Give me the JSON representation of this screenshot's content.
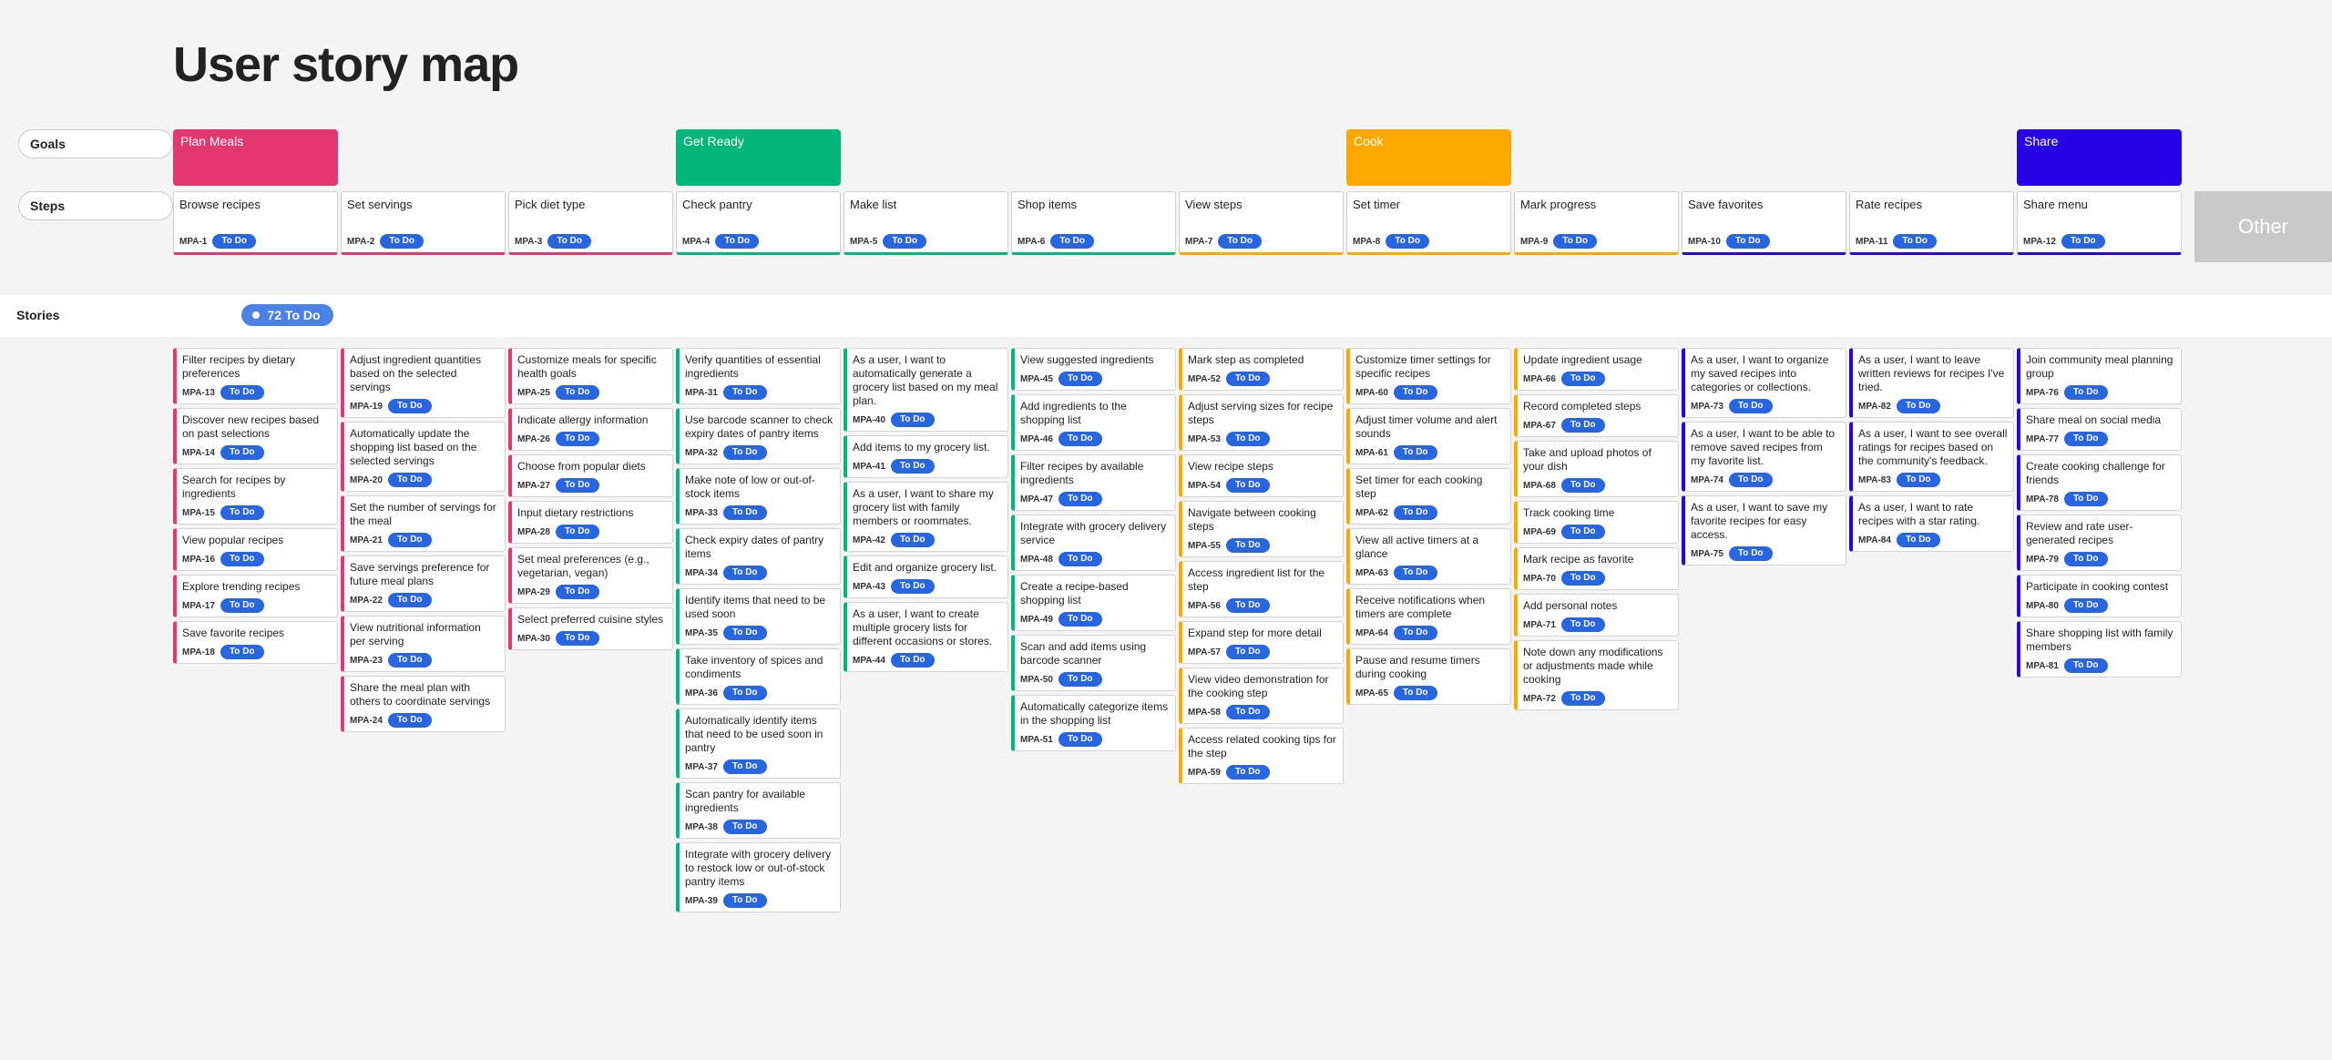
{
  "title": "User story map",
  "labels": {
    "goals": "Goals",
    "steps": "Steps",
    "stories": "Stories",
    "other": "Other"
  },
  "status_label": "To Do",
  "todo_chip": "72 To Do",
  "goals": [
    {
      "title": "Plan Meals",
      "color": "pink",
      "span": 3
    },
    {
      "title": "Get Ready",
      "color": "green",
      "span": 4
    },
    {
      "title": "Cook",
      "color": "orange",
      "span": 4
    },
    {
      "title": "Share",
      "color": "blue",
      "span": 3
    }
  ],
  "steps": [
    {
      "title": "Browse recipes",
      "id": "MPA-1",
      "stripe": "pink"
    },
    {
      "title": "Set servings",
      "id": "MPA-2",
      "stripe": "pink"
    },
    {
      "title": "Pick diet type",
      "id": "MPA-3",
      "stripe": "pink"
    },
    {
      "title": "Check pantry",
      "id": "MPA-4",
      "stripe": "green"
    },
    {
      "title": "Make list",
      "id": "MPA-5",
      "stripe": "green"
    },
    {
      "title": "Shop items",
      "id": "MPA-6",
      "stripe": "green"
    },
    {
      "title": "View steps",
      "id": "MPA-7",
      "stripe": "orange"
    },
    {
      "title": "Set timer",
      "id": "MPA-8",
      "stripe": "orange"
    },
    {
      "title": "Mark progress",
      "id": "MPA-9",
      "stripe": "orange"
    },
    {
      "title": "Save favorites",
      "id": "MPA-10",
      "stripe": "blue"
    },
    {
      "title": "Rate recipes",
      "id": "MPA-11",
      "stripe": "blue"
    },
    {
      "title": "Share menu",
      "id": "MPA-12",
      "stripe": "blue"
    }
  ],
  "stories_columns": [
    [
      {
        "title": "Filter recipes by dietary preferences",
        "id": "MPA-13",
        "stripe": "pink"
      },
      {
        "title": "Discover new recipes based on past selections",
        "id": "MPA-14",
        "stripe": "pink"
      },
      {
        "title": "Search for recipes by ingredients",
        "id": "MPA-15",
        "stripe": "pink"
      },
      {
        "title": "View popular recipes",
        "id": "MPA-16",
        "stripe": "pink"
      },
      {
        "title": "Explore trending recipes",
        "id": "MPA-17",
        "stripe": "pink"
      },
      {
        "title": "Save favorite recipes",
        "id": "MPA-18",
        "stripe": "pink"
      }
    ],
    [
      {
        "title": "Adjust ingredient quantities based on the selected servings",
        "id": "MPA-19",
        "stripe": "pink"
      },
      {
        "title": "Automatically update the shopping list based on the selected servings",
        "id": "MPA-20",
        "stripe": "pink"
      },
      {
        "title": "Set the number of servings for the meal",
        "id": "MPA-21",
        "stripe": "pink"
      },
      {
        "title": "Save servings preference for future meal plans",
        "id": "MPA-22",
        "stripe": "pink"
      },
      {
        "title": "View nutritional information per serving",
        "id": "MPA-23",
        "stripe": "pink"
      },
      {
        "title": "Share the meal plan with others to coordinate servings",
        "id": "MPA-24",
        "stripe": "pink"
      }
    ],
    [
      {
        "title": "Customize meals for specific health goals",
        "id": "MPA-25",
        "stripe": "pink"
      },
      {
        "title": "Indicate allergy information",
        "id": "MPA-26",
        "stripe": "pink"
      },
      {
        "title": "Choose from popular diets",
        "id": "MPA-27",
        "stripe": "pink"
      },
      {
        "title": "Input dietary restrictions",
        "id": "MPA-28",
        "stripe": "pink"
      },
      {
        "title": "Set meal preferences (e.g., vegetarian, vegan)",
        "id": "MPA-29",
        "stripe": "pink"
      },
      {
        "title": "Select preferred cuisine styles",
        "id": "MPA-30",
        "stripe": "pink"
      }
    ],
    [
      {
        "title": "Verify quantities of essential ingredients",
        "id": "MPA-31",
        "stripe": "green"
      },
      {
        "title": "Use barcode scanner to check expiry dates of pantry items",
        "id": "MPA-32",
        "stripe": "green"
      },
      {
        "title": "Make note of low or out-of-stock items",
        "id": "MPA-33",
        "stripe": "green"
      },
      {
        "title": "Check expiry dates of pantry items",
        "id": "MPA-34",
        "stripe": "green"
      },
      {
        "title": "Identify items that need to be used soon",
        "id": "MPA-35",
        "stripe": "green"
      },
      {
        "title": "Take inventory of spices and condiments",
        "id": "MPA-36",
        "stripe": "green"
      },
      {
        "title": "Automatically identify items that need to be used soon in pantry",
        "id": "MPA-37",
        "stripe": "green"
      },
      {
        "title": "Scan pantry for available ingredients",
        "id": "MPA-38",
        "stripe": "green"
      },
      {
        "title": "Integrate with grocery delivery to restock low or out-of-stock pantry items",
        "id": "MPA-39",
        "stripe": "green"
      }
    ],
    [
      {
        "title": "As a user, I want to automatically generate a grocery list based on my meal plan.",
        "id": "MPA-40",
        "stripe": "green"
      },
      {
        "title": "Add items to my grocery list.",
        "id": "MPA-41",
        "stripe": "green"
      },
      {
        "title": "As a user, I want to share my grocery list with family members or roommates.",
        "id": "MPA-42",
        "stripe": "green"
      },
      {
        "title": "Edit and organize grocery list.",
        "id": "MPA-43",
        "stripe": "green"
      },
      {
        "title": "As a user, I want to create multiple grocery lists for different occasions or stores.",
        "id": "MPA-44",
        "stripe": "green"
      }
    ],
    [
      {
        "title": "View suggested ingredients",
        "id": "MPA-45",
        "stripe": "green"
      },
      {
        "title": "Add ingredients to the shopping list",
        "id": "MPA-46",
        "stripe": "green"
      },
      {
        "title": "Filter recipes by available ingredients",
        "id": "MPA-47",
        "stripe": "green"
      },
      {
        "title": "Integrate with grocery delivery service",
        "id": "MPA-48",
        "stripe": "green"
      },
      {
        "title": "Create a recipe-based shopping list",
        "id": "MPA-49",
        "stripe": "green"
      },
      {
        "title": "Scan and add items using barcode scanner",
        "id": "MPA-50",
        "stripe": "green"
      },
      {
        "title": "Automatically categorize items in the shopping list",
        "id": "MPA-51",
        "stripe": "green"
      }
    ],
    [
      {
        "title": "Mark step as completed",
        "id": "MPA-52",
        "stripe": "orange"
      },
      {
        "title": "Adjust serving sizes for recipe steps",
        "id": "MPA-53",
        "stripe": "orange"
      },
      {
        "title": "View recipe steps",
        "id": "MPA-54",
        "stripe": "orange"
      },
      {
        "title": "Navigate between cooking steps",
        "id": "MPA-55",
        "stripe": "orange"
      },
      {
        "title": "Access ingredient list for the step",
        "id": "MPA-56",
        "stripe": "orange"
      },
      {
        "title": "Expand step for more detail",
        "id": "MPA-57",
        "stripe": "orange"
      },
      {
        "title": "View video demonstration for the cooking step",
        "id": "MPA-58",
        "stripe": "orange"
      },
      {
        "title": "Access related cooking tips for the step",
        "id": "MPA-59",
        "stripe": "orange"
      }
    ],
    [
      {
        "title": "Customize timer settings for specific recipes",
        "id": "MPA-60",
        "stripe": "orange"
      },
      {
        "title": "Adjust timer volume and alert sounds",
        "id": "MPA-61",
        "stripe": "orange"
      },
      {
        "title": "Set timer for each cooking step",
        "id": "MPA-62",
        "stripe": "orange"
      },
      {
        "title": "View all active timers at a glance",
        "id": "MPA-63",
        "stripe": "orange"
      },
      {
        "title": "Receive notifications when timers are complete",
        "id": "MPA-64",
        "stripe": "orange"
      },
      {
        "title": "Pause and resume timers during cooking",
        "id": "MPA-65",
        "stripe": "orange"
      }
    ],
    [
      {
        "title": "Update ingredient usage",
        "id": "MPA-66",
        "stripe": "orange"
      },
      {
        "title": "Record completed steps",
        "id": "MPA-67",
        "stripe": "orange"
      },
      {
        "title": "Take and upload photos of your dish",
        "id": "MPA-68",
        "stripe": "orange"
      },
      {
        "title": "Track cooking time",
        "id": "MPA-69",
        "stripe": "orange"
      },
      {
        "title": "Mark recipe as favorite",
        "id": "MPA-70",
        "stripe": "orange"
      },
      {
        "title": "Add personal notes",
        "id": "MPA-71",
        "stripe": "orange"
      },
      {
        "title": "Note down any modifications or adjustments made while cooking",
        "id": "MPA-72",
        "stripe": "orange"
      }
    ],
    [
      {
        "title": "As a user, I want to organize my saved recipes into categories or collections.",
        "id": "MPA-73",
        "stripe": "blue"
      },
      {
        "title": "As a user, I want to be able to remove saved recipes from my favorite list.",
        "id": "MPA-74",
        "stripe": "blue"
      },
      {
        "title": "As a user, I want to save my favorite recipes for easy access.",
        "id": "MPA-75",
        "stripe": "blue"
      }
    ],
    [
      {
        "title": "As a user, I want to leave written reviews for recipes I've tried.",
        "id": "MPA-82",
        "stripe": "blue"
      },
      {
        "title": "As a user, I want to see overall ratings for recipes based on the community's feedback.",
        "id": "MPA-83",
        "stripe": "blue"
      },
      {
        "title": "As a user, I want to rate recipes with a star rating.",
        "id": "MPA-84",
        "stripe": "blue"
      }
    ],
    [
      {
        "title": "Join community meal planning group",
        "id": "MPA-76",
        "stripe": "blue"
      },
      {
        "title": "Share meal on social media",
        "id": "MPA-77",
        "stripe": "blue"
      },
      {
        "title": "Create cooking challenge for friends",
        "id": "MPA-78",
        "stripe": "blue"
      },
      {
        "title": "Review and rate user-generated recipes",
        "id": "MPA-79",
        "stripe": "blue"
      },
      {
        "title": "Participate in cooking contest",
        "id": "MPA-80",
        "stripe": "blue"
      },
      {
        "title": "Share shopping list with family members",
        "id": "MPA-81",
        "stripe": "blue"
      }
    ]
  ]
}
